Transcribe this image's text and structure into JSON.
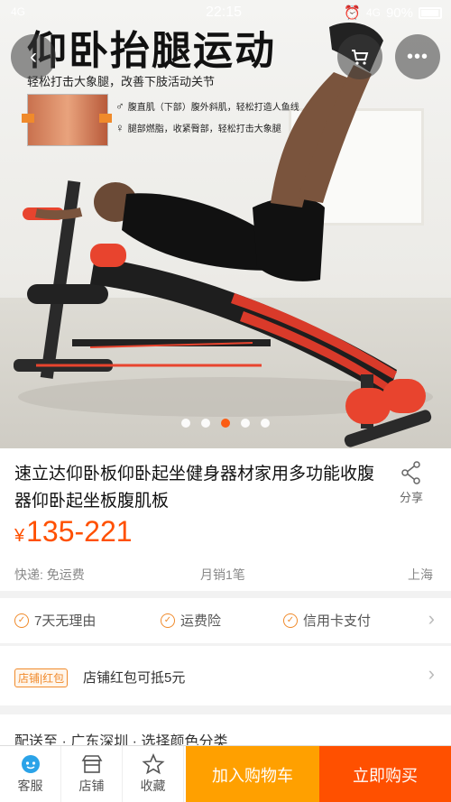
{
  "status_bar": {
    "network_left": "4G",
    "time": "22:15",
    "network_right": "4G",
    "battery": "90%"
  },
  "hero": {
    "title": "仰卧抬腿运动",
    "subtitle": "轻松打击大象腿，改善下肢活动关节",
    "lines": [
      {
        "symbol": "♂",
        "text": "腹直肌（下部）腹外斜肌，轻松打造人鱼线"
      },
      {
        "symbol": "♀",
        "text": "腿部燃脂，收紧臀部，轻松打击大象腿"
      }
    ],
    "slides_total": 5,
    "slide_active": 3
  },
  "product": {
    "title": "速立达仰卧板仰卧起坐健身器材家用多功能收腹器仰卧起坐板腹肌板",
    "price_symbol": "¥",
    "price": "135-221",
    "share_label": "分享",
    "shipping": "快递: 免运费",
    "monthly_sales": "月销1笔",
    "location": "上海"
  },
  "services": [
    "7天无理由",
    "运费险",
    "信用卡支付"
  ],
  "shop_promo": {
    "badge": "店铺|红包",
    "text": "店铺红包可抵5元"
  },
  "next_row": {
    "text": "配送至 · 广东深圳 · 选择颜色分类"
  },
  "bottom_bar": {
    "tabs": [
      {
        "label": "客服",
        "icon": "customer-service-icon"
      },
      {
        "label": "店铺",
        "icon": "shop-icon"
      },
      {
        "label": "收藏",
        "icon": "star-icon"
      }
    ],
    "add_to_cart": "加入购物车",
    "buy_now": "立即购买"
  },
  "colors": {
    "accent": "#ff5000",
    "cart_button": "#ffa000",
    "buy_button": "#ff5000"
  }
}
